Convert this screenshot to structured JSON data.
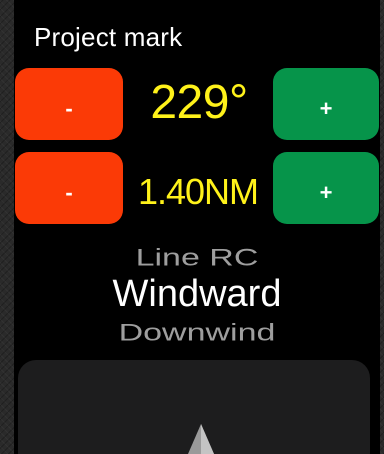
{
  "title": "Project mark",
  "heading": {
    "minus_label": "-",
    "value": "229°",
    "plus_label": "+"
  },
  "distance": {
    "minus_label": "-",
    "value": "1.40NM",
    "plus_label": "+"
  },
  "picker": {
    "items": [
      "Line RC",
      "Windward",
      "Downwind"
    ],
    "selected": "Windward"
  },
  "icons": {
    "compass": "compass-needle-icon"
  },
  "colors": {
    "minus": "#fb3a06",
    "plus": "#06944a",
    "value": "#fff21a"
  }
}
